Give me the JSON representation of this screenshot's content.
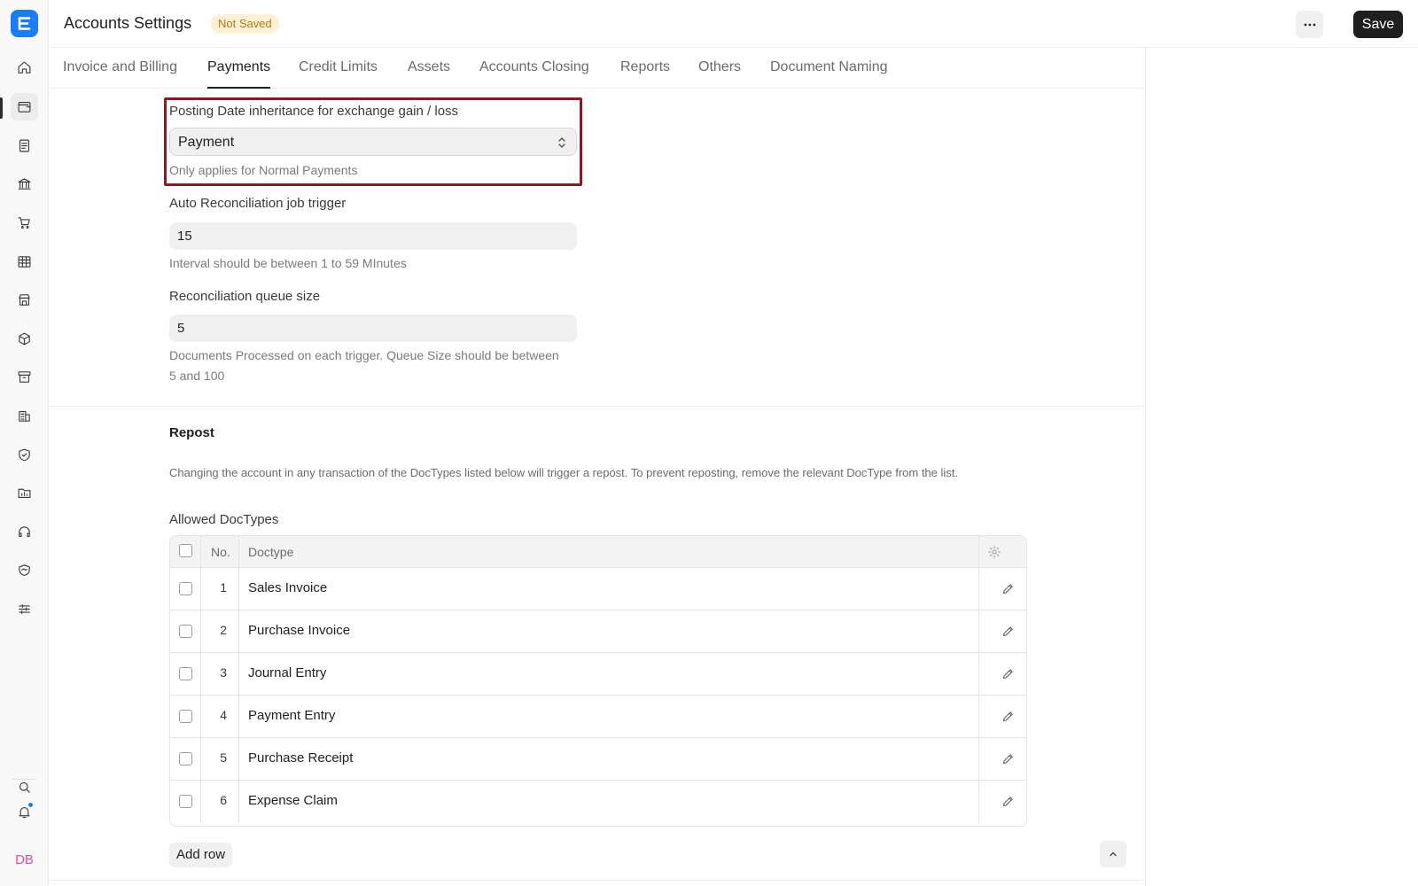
{
  "header": {
    "title": "Accounts Settings",
    "status": "Not Saved",
    "more_label": "···",
    "save_label": "Save"
  },
  "sidebar": {
    "icons": [
      "home-icon",
      "wallet-icon",
      "document-icon",
      "bank-icon",
      "cart-icon",
      "table-icon",
      "store-icon",
      "box-icon",
      "archive-icon",
      "building-icon",
      "shield-icon",
      "folder-chart-icon",
      "headset-icon",
      "handshake-icon",
      "sliders-icon"
    ],
    "active_index": 1,
    "avatar_initials": "DB"
  },
  "tabs": [
    {
      "label": "Invoice and Billing"
    },
    {
      "label": "Payments"
    },
    {
      "label": "Credit Limits"
    },
    {
      "label": "Assets"
    },
    {
      "label": "Accounts Closing"
    },
    {
      "label": "Reports"
    },
    {
      "label": "Others"
    },
    {
      "label": "Document Naming"
    }
  ],
  "active_tab": "Payments",
  "fields": {
    "posting_date": {
      "label": "Posting Date inheritance for exchange gain / loss",
      "value": "Payment",
      "help": "Only applies for Normal Payments"
    },
    "auto_reconciliation": {
      "label": "Auto Reconciliation job trigger",
      "value": "15",
      "help": "Interval should be between 1 to 59 MInutes"
    },
    "queue_size": {
      "label": "Reconciliation queue size",
      "value": "5",
      "help": "Documents Processed on each trigger. Queue Size should be between 5 and 100"
    }
  },
  "repost": {
    "title": "Repost",
    "description": "Changing the account in any transaction of the DocTypes listed below will trigger a repost. To prevent reposting, remove the relevant DocType from the list.",
    "table_label": "Allowed DocTypes",
    "columns": {
      "no": "No.",
      "doctype": "Doctype"
    },
    "rows": [
      {
        "no": "1",
        "doctype": "Sales Invoice"
      },
      {
        "no": "2",
        "doctype": "Purchase Invoice"
      },
      {
        "no": "3",
        "doctype": "Journal Entry"
      },
      {
        "no": "4",
        "doctype": "Payment Entry"
      },
      {
        "no": "5",
        "doctype": "Purchase Receipt"
      },
      {
        "no": "6",
        "doctype": "Expense Claim"
      }
    ],
    "add_row_label": "Add row"
  },
  "colors": {
    "brand": "#1c7cf4",
    "highlight_border": "#8b1b22",
    "badge_bg": "#fdf0d5",
    "badge_text": "#b07a1a",
    "avatar_text": "#e44fa4"
  }
}
